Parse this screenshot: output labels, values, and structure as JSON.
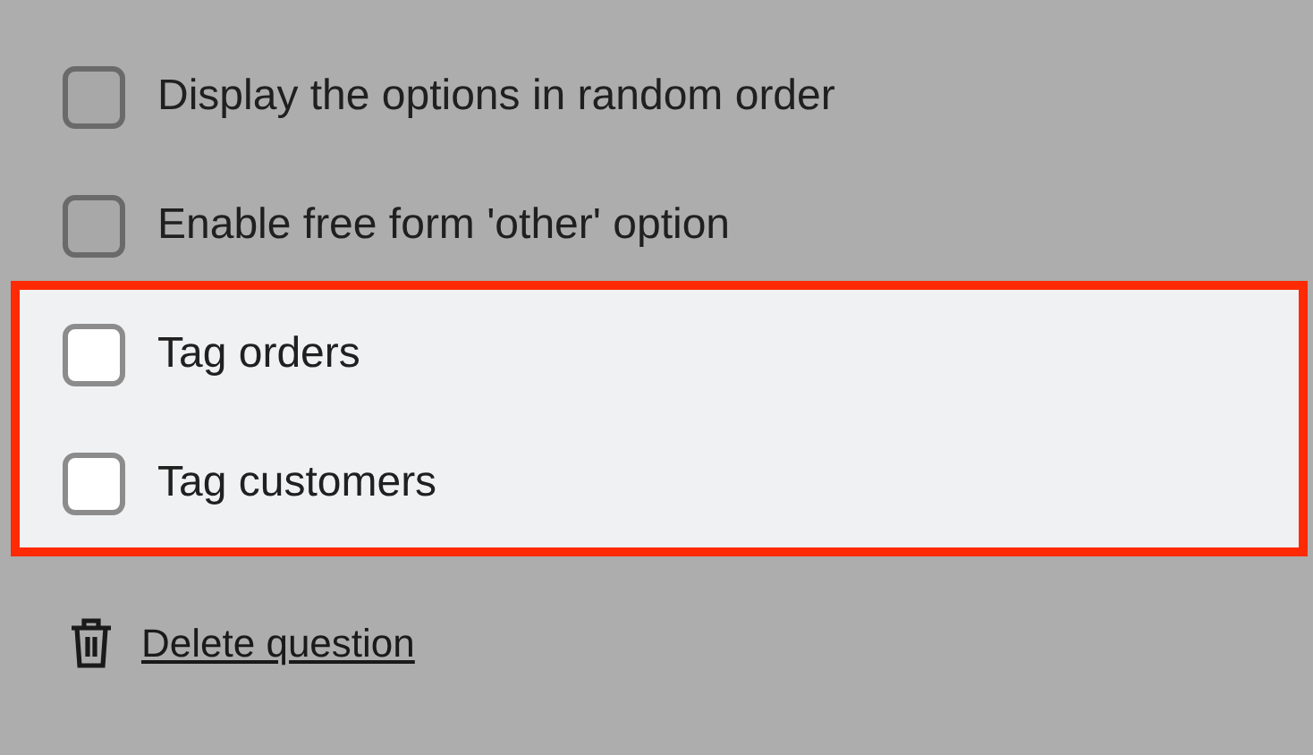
{
  "options": [
    {
      "label": "Display the options in random order",
      "checked": false
    },
    {
      "label": "Enable free form 'other' option",
      "checked": false
    }
  ],
  "highlighted_options": [
    {
      "label": "Tag orders",
      "checked": false
    },
    {
      "label": "Tag customers",
      "checked": false
    }
  ],
  "delete_link": "Delete question"
}
